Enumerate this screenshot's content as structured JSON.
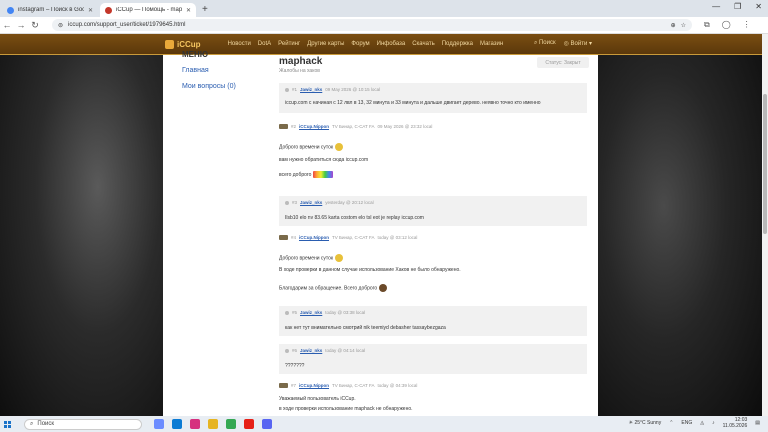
{
  "tabs": [
    {
      "title": "instagram – Поиск в Google",
      "color": "#4285f4"
    },
    {
      "title": "iCCup — Помощь - maphack",
      "color": "#c4372a"
    }
  ],
  "address": {
    "url": "iccup.com/support_user/ticket/1979645.html"
  },
  "site_nav": {
    "brand": "iCCup",
    "items": [
      "Новости",
      "DotA",
      "Рейтинг",
      "Другие карты",
      "Форум",
      "Инфобаза",
      "Скачать",
      "Поддержка",
      "Магазин"
    ],
    "search_label": "Поиск",
    "lang_label": "Войти"
  },
  "left_menu": {
    "header": "МЕНЮ",
    "home": "Главная",
    "my_questions": "Мои вопросы (0)"
  },
  "ticket": {
    "title": "maphack",
    "subtitle": "Жалобы на хаков",
    "status": "Статус: Закрыт"
  },
  "messages": [
    {
      "num": "#1",
      "author": "Jawiz_nks",
      "role": "",
      "date": "09 May 2026 @ 10:15 local",
      "lines": [
        "iccup.com с начиная с 12 лвл в 13, 32 минута и 33 минута и дальше двигает дерево. неявно точно кто именно"
      ]
    },
    {
      "num": "#2",
      "author": "iCCup.Nippon",
      "role": "TV Бинар, С-САТ FA",
      "date": "09 May 2026 @ 23:32 local",
      "lines": [
        "Доброго времени суток",
        "вам нужно обратиться сюда iccup.com",
        "всего доброго"
      ]
    },
    {
      "num": "#3",
      "author": "Jawiz_nks",
      "role": "",
      "date": "yesterday @ 20:12 local",
      "lines": [
        "Ilsb10 elo nv 83.65 karta costom elo tsl eot je replay iccup.com"
      ]
    },
    {
      "num": "#4",
      "author": "iCCup.Nippon",
      "role": "TV Бинар, С-САТ FA",
      "date": "today @ 03:12 local",
      "lines": [
        "Доброго времени суток",
        "В ходе проверки в данном случае использование Хаков не было обнаружено.",
        "Благодарим за обращение. Всего доброго"
      ]
    },
    {
      "num": "#5",
      "author": "Jawiz_nks",
      "role": "",
      "date": "today @ 03:38 local",
      "lines": [
        "как нет тут внимательно смотрий nik teemiyd debasher tassaybezgaza"
      ]
    },
    {
      "num": "#6",
      "author": "Jawiz_nks",
      "role": "",
      "date": "today @ 04:14 local",
      "lines": [
        "???????"
      ]
    },
    {
      "num": "#7",
      "author": "iCCup.Nippon",
      "role": "TV Бинар, С-САТ FA",
      "date": "today @ 04:39 local",
      "lines": [
        "Уважаемый пользователь iCCup.",
        "в ходе проверки использование maphack не обнаружено."
      ]
    }
  ],
  "taskbar": {
    "search_placeholder": "Поиск",
    "weather": "25°C Sunny",
    "lang": "ENG",
    "time": "12:03",
    "date": "11.05.2026"
  }
}
